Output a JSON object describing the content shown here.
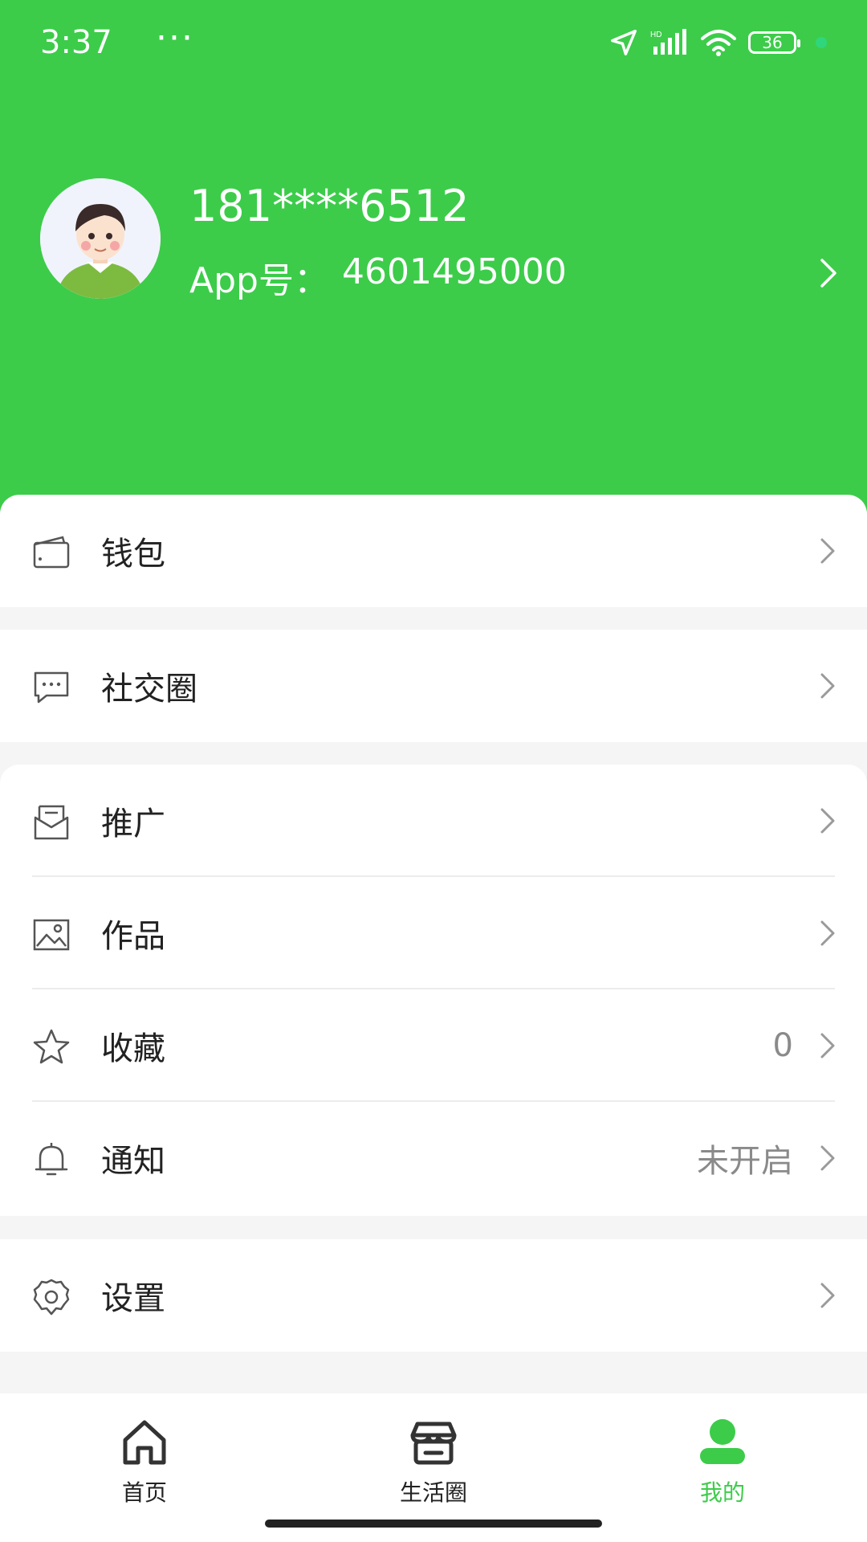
{
  "status_bar": {
    "time": "3:37",
    "more": "···",
    "battery": "36",
    "icons": [
      "location-icon",
      "signal-icon",
      "wifi-icon",
      "battery-icon"
    ]
  },
  "profile": {
    "phone": "181****6512",
    "app_id_label": "App号：",
    "app_id_value": "4601495000"
  },
  "menu": {
    "wallet": {
      "label": "钱包",
      "icon": "wallet-icon"
    },
    "social": {
      "label": "社交圈",
      "icon": "chat-icon"
    },
    "promote": {
      "label": "推广",
      "icon": "mail-icon"
    },
    "works": {
      "label": "作品",
      "icon": "image-icon"
    },
    "favorites": {
      "label": "收藏",
      "value": "0",
      "icon": "star-icon"
    },
    "notify": {
      "label": "通知",
      "value": "未开启",
      "icon": "bell-icon"
    },
    "settings": {
      "label": "设置",
      "icon": "gear-icon"
    }
  },
  "tabs": {
    "home": "首页",
    "life": "生活圈",
    "mine": "我的"
  },
  "colors": {
    "brand_green": "#3ccc4a",
    "background": "#f5f5f5",
    "secondary_text": "#8a8a8a"
  }
}
